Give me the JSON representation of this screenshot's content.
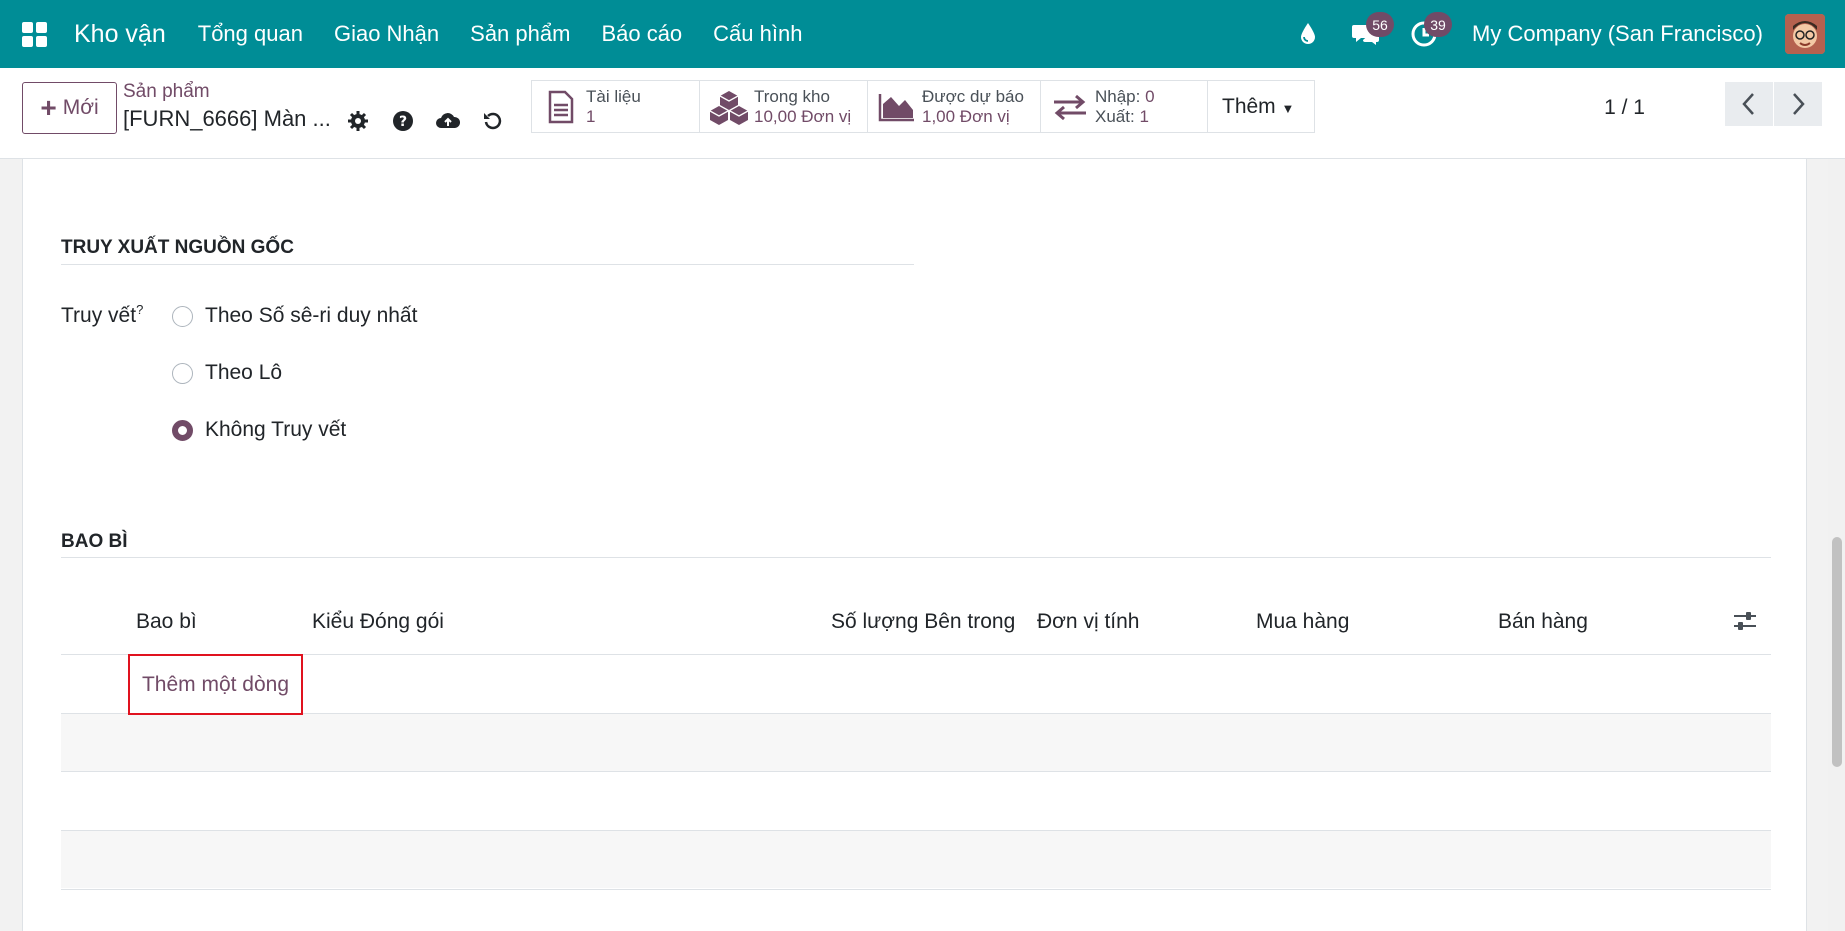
{
  "navbar": {
    "app_title": "Kho vận",
    "menu": [
      "Tổng quan",
      "Giao Nhận",
      "Sản phẩm",
      "Báo cáo",
      "Cấu hình"
    ],
    "messages_badge": "56",
    "activities_badge": "39",
    "company": "My Company (San Francisco)"
  },
  "control": {
    "new_label": "Mới",
    "breadcrumb_parent": "Sản phẩm",
    "breadcrumb_current": "[FURN_6666] Màn ...",
    "smart_buttons": {
      "documents": {
        "label": "Tài liệu",
        "value": "1"
      },
      "on_hand": {
        "label": "Trong kho",
        "value": "10,00 Đơn vị"
      },
      "forecasted": {
        "label": "Được dự báo",
        "value": "1,00 Đơn vị"
      },
      "in_label": "Nhập:",
      "in_value": "0",
      "out_label": "Xuất:",
      "out_value": "1",
      "more": "Thêm"
    },
    "pager": "1 / 1"
  },
  "form": {
    "traceability": {
      "title": "TRUY XUẤT NGUỒN GỐC",
      "label": "Truy vết",
      "tooltip_mark": "?",
      "options": [
        "Theo Số sê-ri duy nhất",
        "Theo Lô",
        "Không Truy vết"
      ],
      "selected": "Không Truy vết"
    },
    "packaging": {
      "title": "BAO BÌ",
      "columns": [
        "Bao bì",
        "Kiểu Đóng gói",
        "Số lượng Bên trong",
        "Đơn vị tính",
        "Mua hàng",
        "Bán hàng"
      ],
      "add_line": "Thêm một dòng"
    }
  },
  "colors": {
    "navbar": "#008d96",
    "primary": "#714b67",
    "highlight": "#e0121f"
  }
}
